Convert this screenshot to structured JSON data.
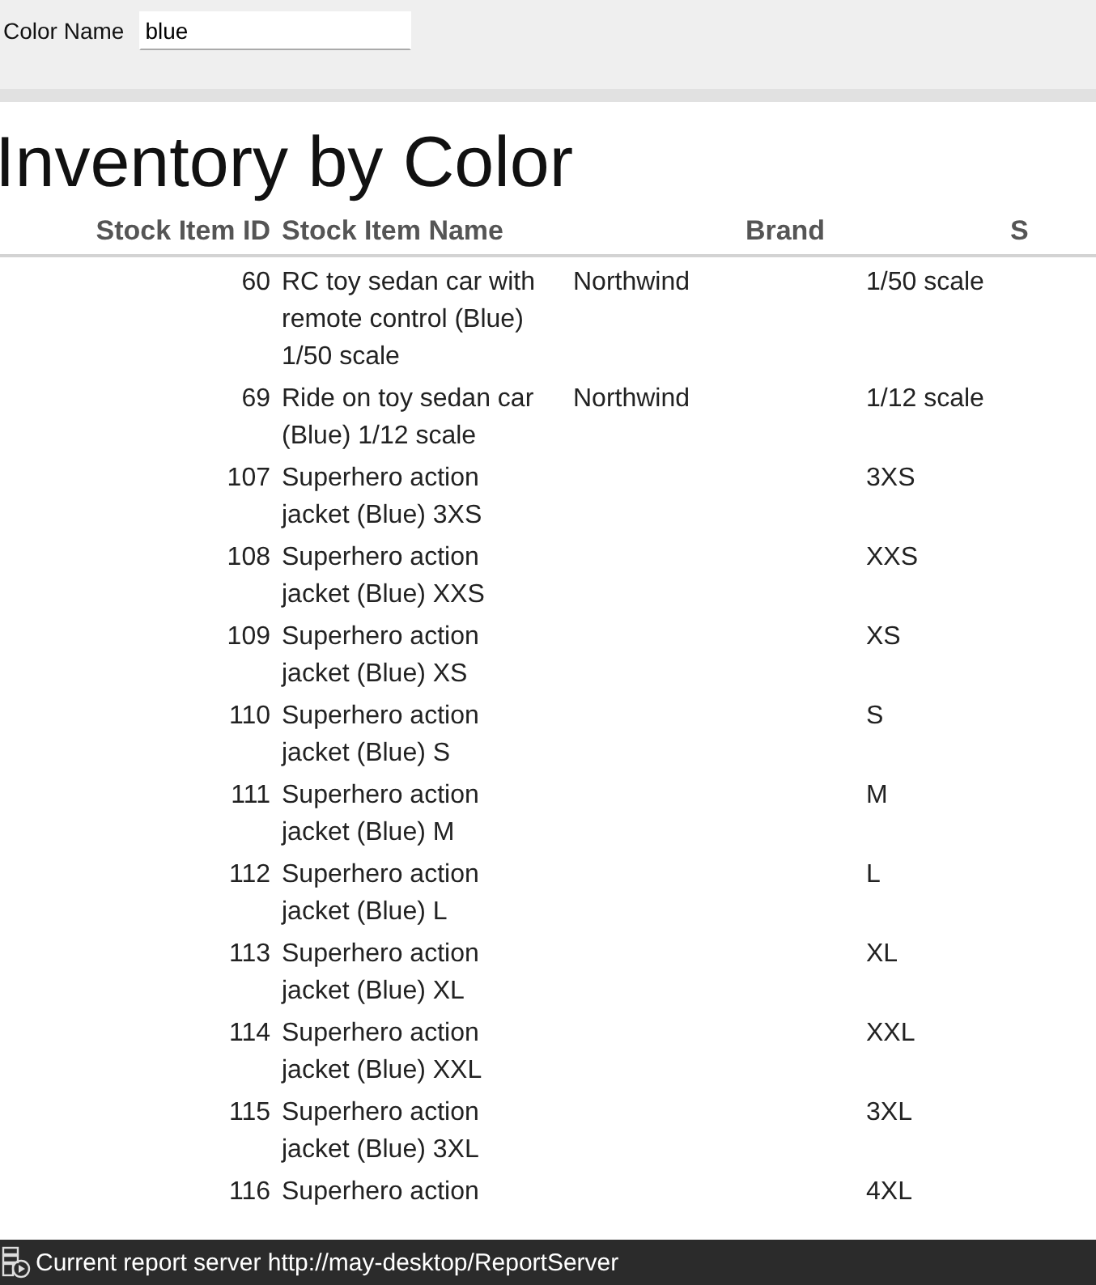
{
  "parameters": {
    "label": "Color Name",
    "value": "blue"
  },
  "report": {
    "title": "Inventory by Color",
    "columns": [
      "Stock Item ID",
      "Stock Item Name",
      "Brand",
      "S"
    ],
    "rows": [
      {
        "id": "60",
        "name": "RC toy sedan car with remote control (Blue) 1/50 scale",
        "brand": "Northwind",
        "size": "1/50 scale"
      },
      {
        "id": "69",
        "name": "Ride on toy sedan car (Blue) 1/12 scale",
        "brand": "Northwind",
        "size": "1/12 scale"
      },
      {
        "id": "107",
        "name": "Superhero action jacket (Blue) 3XS",
        "size": "3XS"
      },
      {
        "id": "108",
        "name": "Superhero action jacket (Blue) XXS",
        "size": "XXS"
      },
      {
        "id": "109",
        "name": "Superhero action jacket (Blue) XS",
        "size": "XS"
      },
      {
        "id": "110",
        "name": "Superhero action jacket (Blue) S",
        "size": "S"
      },
      {
        "id": "111",
        "name": "Superhero action jacket (Blue) M",
        "size": "M"
      },
      {
        "id": "112",
        "name": "Superhero action jacket (Blue) L",
        "size": "L"
      },
      {
        "id": "113",
        "name": "Superhero action jacket (Blue) XL",
        "size": "XL"
      },
      {
        "id": "114",
        "name": "Superhero action jacket (Blue) XXL",
        "size": "XXL"
      },
      {
        "id": "115",
        "name": "Superhero action jacket (Blue) 3XL",
        "size": "3XL"
      },
      {
        "id": "116",
        "name": "Superhero action",
        "size": "4XL"
      }
    ]
  },
  "status_bar": {
    "text": "Current report server http://may-desktop/ReportServer"
  }
}
